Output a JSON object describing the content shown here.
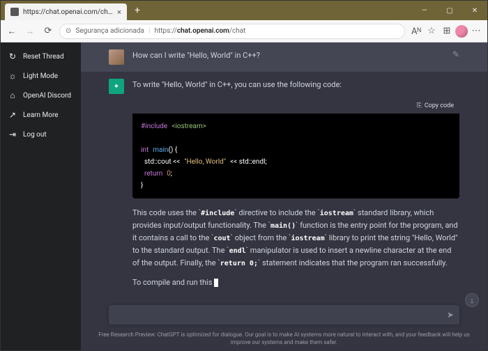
{
  "browser": {
    "tab_title": "https://chat.openai.com/chat",
    "security_label": "Segurança adicionada",
    "url_plain_pre": "https://",
    "url_bold": "chat.openai.com",
    "url_plain_post": "/chat"
  },
  "sidebar": {
    "items": [
      {
        "icon": "↻",
        "label": "Reset Thread"
      },
      {
        "icon": "☼",
        "label": "Light Mode"
      },
      {
        "icon": "⌂",
        "label": "OpenAI Discord"
      },
      {
        "icon": "↗",
        "label": "Learn More"
      },
      {
        "icon": "⇥",
        "label": "Log out"
      }
    ]
  },
  "chat": {
    "user_msg": "How can I write \"Hello, World\" in C++?",
    "assistant_intro": "To write \"Hello, World\" in C++, you can use the following code:",
    "copy_label": "Copy code",
    "code": {
      "l1a": "#include",
      "l1b": "<iostream>",
      "l2a": "int",
      "l2b": "main",
      "l2c": "() {",
      "l3a": "  std::cout <<",
      "l3b": "\"Hello, World\"",
      "l3c": "<< std::endl;",
      "l4a": "  return",
      "l4b": "0",
      "l4c": ";",
      "l5": "}"
    },
    "exp_1": "This code uses the `",
    "exp_inc": "#include",
    "exp_2": "` directive to include the `",
    "exp_ios": "iostream",
    "exp_3": "` standard library, which provides input/output functionality. The `",
    "exp_main": "main()",
    "exp_4": "` function is the entry point for the program, and it contains a call to the `",
    "exp_cout": "cout",
    "exp_5": "` object from the `",
    "exp_ios2": "iostream",
    "exp_6": "` library to print the string \"Hello, World\" to the standard output. The `",
    "exp_endl": "endl",
    "exp_7": "` manipulator is used to insert a newline character at the end of the output. Finally, the `",
    "exp_ret": "return 0;",
    "exp_8": "` statement indicates that the program ran successfully.",
    "continue": "To compile and run this "
  },
  "input": {
    "placeholder": ""
  },
  "footer": "Free Research Preview: ChatGPT is optimized for dialogue. Our goal is to make AI systems more natural to interact with, and your feedback will help us improve our systems and make them safer."
}
